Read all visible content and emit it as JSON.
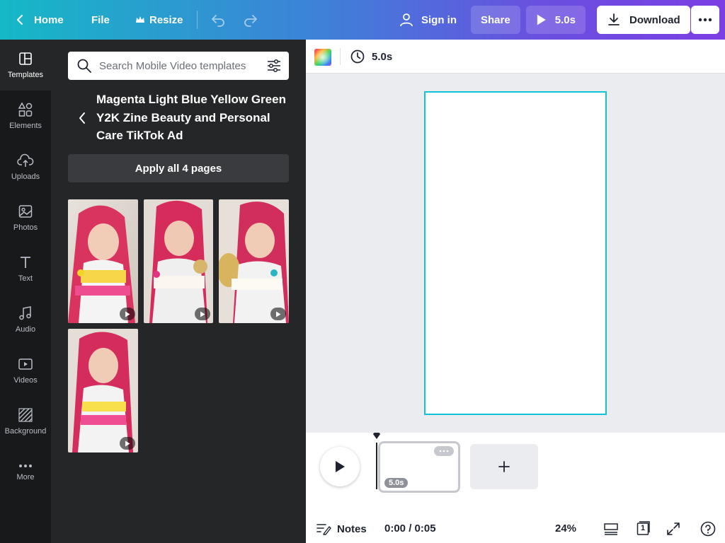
{
  "topbar": {
    "home_label": "Home",
    "file_label": "File",
    "resize_label": "Resize",
    "signin_label": "Sign in",
    "share_label": "Share",
    "preview_label": "5.0s",
    "download_label": "Download"
  },
  "rail": {
    "items": [
      {
        "label": "Templates",
        "icon": "templates-icon"
      },
      {
        "label": "Elements",
        "icon": "elements-icon"
      },
      {
        "label": "Uploads",
        "icon": "upload-cloud-icon"
      },
      {
        "label": "Photos",
        "icon": "photo-icon"
      },
      {
        "label": "Text",
        "icon": "text-icon"
      },
      {
        "label": "Audio",
        "icon": "music-note-icon"
      },
      {
        "label": "Videos",
        "icon": "video-icon"
      },
      {
        "label": "Background",
        "icon": "background-pattern-icon"
      },
      {
        "label": "More",
        "icon": "more-dots-icon"
      }
    ]
  },
  "panel": {
    "search_placeholder": "Search Mobile Video templates",
    "template_title": "Magenta Light Blue Yellow Green Y2K Zine Beauty and Personal Care TikTok Ad",
    "apply_label": "Apply all 4 pages"
  },
  "toolbar2": {
    "duration_label": "5.0s"
  },
  "timeline": {
    "clip_duration": "5.0s",
    "notes_label": "Notes",
    "time_label": "0:00 / 0:05",
    "zoom_label": "24%",
    "page_count": "1"
  },
  "colors": {
    "accent": "#13c2d4",
    "topbar_start": "#15b8c7",
    "topbar_end": "#7b3fe4"
  }
}
